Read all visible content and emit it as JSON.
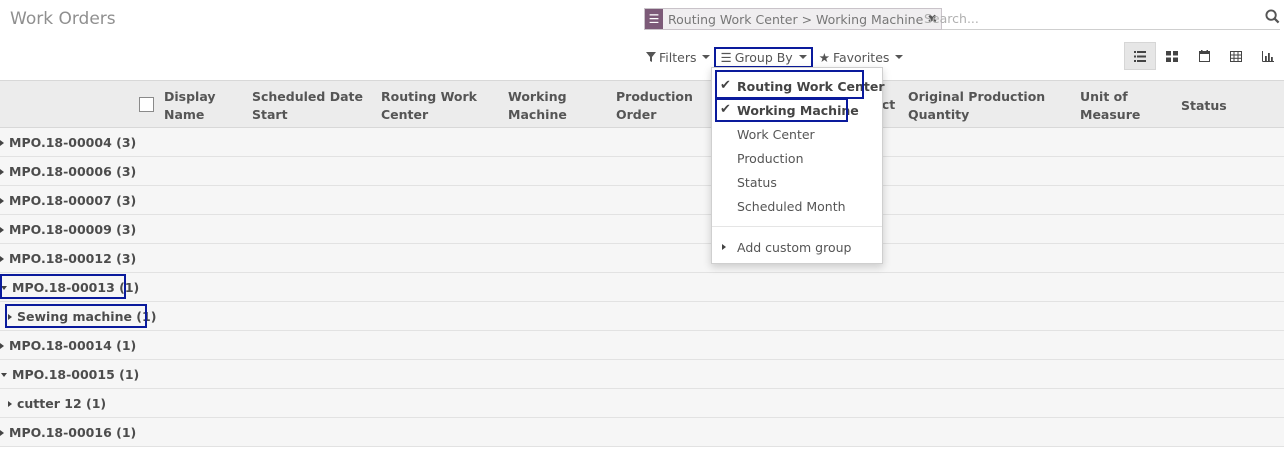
{
  "page": {
    "title": "Work Orders"
  },
  "search": {
    "facet": "Routing Work Center > Working Machine",
    "facet_close": "✖",
    "placeholder": "Search..."
  },
  "controls": {
    "filters_label": "Filters",
    "groupby_label": "Group By",
    "favorites_label": "Favorites"
  },
  "views": [
    "list-view-icon",
    "kanban-view-icon",
    "calendar-view-icon",
    "pivot-view-icon",
    "graph-view-icon"
  ],
  "columns": [
    {
      "label": "Display\nName"
    },
    {
      "label": "Scheduled Date\nStart"
    },
    {
      "label": "Routing Work\nCenter"
    },
    {
      "label": "Working\nMachine"
    },
    {
      "label": "Production\nOrder"
    },
    {
      "label": "uct"
    },
    {
      "label": "Original Production\nQuantity"
    },
    {
      "label": "Unit of\nMeasure"
    },
    {
      "label": "Status"
    }
  ],
  "rows": [
    {
      "label": "MPO.18-00004 (3)",
      "expanded": false,
      "level": 0
    },
    {
      "label": "MPO.18-00006 (3)",
      "expanded": false,
      "level": 0
    },
    {
      "label": "MPO.18-00007 (3)",
      "expanded": false,
      "level": 0
    },
    {
      "label": "MPO.18-00009 (3)",
      "expanded": false,
      "level": 0
    },
    {
      "label": "MPO.18-00012 (3)",
      "expanded": false,
      "level": 0
    },
    {
      "label": "MPO.18-00013 (1)",
      "expanded": true,
      "level": 0
    },
    {
      "label": "Sewing machine (1)",
      "expanded": false,
      "level": 1
    },
    {
      "label": "MPO.18-00014 (1)",
      "expanded": false,
      "level": 0
    },
    {
      "label": "MPO.18-00015 (1)",
      "expanded": true,
      "level": 0
    },
    {
      "label": "cutter 12 (1)",
      "expanded": false,
      "level": 1
    },
    {
      "label": "MPO.18-00016 (1)",
      "expanded": false,
      "level": 0
    }
  ],
  "groupby_menu": {
    "items": [
      {
        "label": "Routing Work Center",
        "selected": true
      },
      {
        "label": "Working Machine",
        "selected": true
      },
      {
        "label": "Work Center",
        "selected": false
      },
      {
        "label": "Production",
        "selected": false
      },
      {
        "label": "Status",
        "selected": false
      },
      {
        "label": "Scheduled Month",
        "selected": false
      }
    ],
    "custom_label": "Add custom group"
  },
  "colors": {
    "highlight": "#0a1a9c",
    "facet_icon": "#7c5a78"
  }
}
